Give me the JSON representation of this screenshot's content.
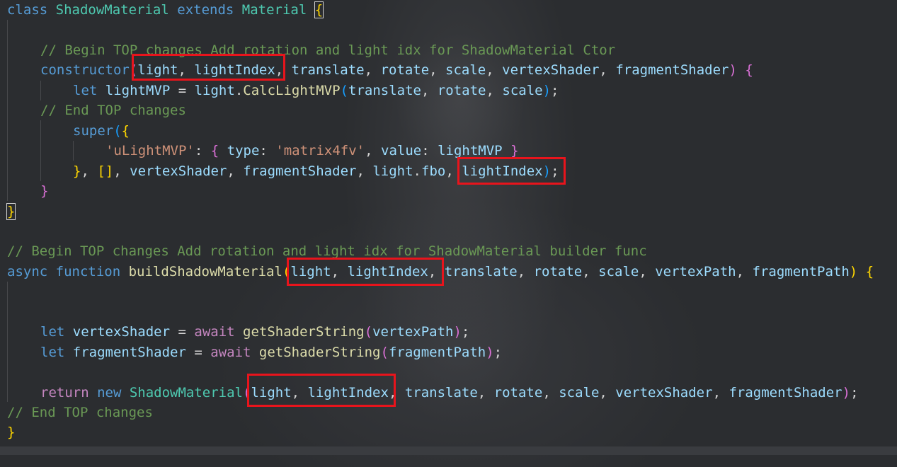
{
  "code": {
    "l1": {
      "t1": "class",
      "t2": "ShadowMaterial",
      "t3": "extends",
      "t4": "Material",
      "t5": "{"
    },
    "l3": {
      "t1": "// Begin TOP changes Add rotation and light idx for ShadowMaterial Ctor"
    },
    "l4": {
      "t1": "constructor",
      "t2": "(",
      "t3": "light",
      "t4": ", ",
      "t5": "lightIndex",
      "t6": ", ",
      "t7": "translate",
      "t8": ", ",
      "t9": "rotate",
      "t10": ", ",
      "t11": "scale",
      "t12": ", ",
      "t13": "vertexShader",
      "t14": ", ",
      "t15": "fragmentShader",
      "t16": ")",
      "t17": " ",
      "t18": "{"
    },
    "l5": {
      "t1": "let",
      "t2": " lightMVP",
      "t3": " = ",
      "t4": "light",
      "t5": ".",
      "t6": "CalcLightMVP",
      "t7": "(",
      "t8": "translate",
      "t9": ", ",
      "t10": "rotate",
      "t11": ", ",
      "t12": "scale",
      "t13": ")",
      "t14": ";"
    },
    "l6": {
      "t1": "// End TOP changes"
    },
    "l7": {
      "t1": "super",
      "t2": "(",
      "t3": "{"
    },
    "l8": {
      "t1": "'uLightMVP'",
      "t2": ": ",
      "t3": "{",
      "t4": " type",
      "t5": ": ",
      "t6": "'matrix4fv'",
      "t7": ", ",
      "t8": "value",
      "t9": ": ",
      "t10": "lightMVP",
      "t11": " ",
      "t12": "}"
    },
    "l9": {
      "t1": "}",
      "t2": ", ",
      "t3": "[]",
      "t4": ", ",
      "t5": "vertexShader",
      "t6": ", ",
      "t7": "fragmentShader",
      "t8": ", ",
      "t9": "light",
      "t10": ".",
      "t11": "fbo",
      "t12": ", ",
      "t13": "lightIndex",
      "t14": ")",
      "t15": ";"
    },
    "l10": {
      "t1": "}"
    },
    "l11": {
      "t1": "}"
    },
    "l13": {
      "t1": "// Begin TOP changes Add rotation and light idx for ShadowMaterial builder func"
    },
    "l14": {
      "t1": "async",
      "t2": " function",
      "t3": " buildShadowMaterial",
      "t4": "(",
      "t5": "light",
      "t6": ", ",
      "t7": "lightIndex",
      "t8": ", ",
      "t9": "translate",
      "t10": ", ",
      "t11": "rotate",
      "t12": ", ",
      "t13": "scale",
      "t14": ", ",
      "t15": "vertexPath",
      "t16": ", ",
      "t17": "fragmentPath",
      "t18": ")",
      "t19": " ",
      "t20": "{"
    },
    "l17": {
      "t1": "let",
      "t2": " vertexShader",
      "t3": " = ",
      "t4": "await",
      "t5": " getShaderString",
      "t6": "(",
      "t7": "vertexPath",
      "t8": ")",
      "t9": ";"
    },
    "l18": {
      "t1": "let",
      "t2": " fragmentShader",
      "t3": " = ",
      "t4": "await",
      "t5": " getShaderString",
      "t6": "(",
      "t7": "fragmentPath",
      "t8": ")",
      "t9": ";"
    },
    "l20": {
      "t1": "return",
      "t2": " new",
      "t3": " ShadowMaterial",
      "t4": "(",
      "t5": "light",
      "t6": ", ",
      "t7": "lightIndex",
      "t8": ", ",
      "t9": "translate",
      "t10": ", ",
      "t11": "rotate",
      "t12": ", ",
      "t13": "scale",
      "t14": ", ",
      "t15": "vertexShader",
      "t16": ", ",
      "t17": "fragmentShader",
      "t18": ")",
      "t19": ";"
    },
    "l21": {
      "t1": "// End TOP changes"
    },
    "l22": {
      "t1": "}"
    }
  },
  "colors": {
    "highlight_box": "#e8141c",
    "keyword": "#569cd6",
    "control_keyword": "#c586c0",
    "class_name": "#4ec9b0",
    "function": "#dcdcaa",
    "variable": "#9cdcfe",
    "string": "#ce9178",
    "comment": "#6a9955"
  }
}
